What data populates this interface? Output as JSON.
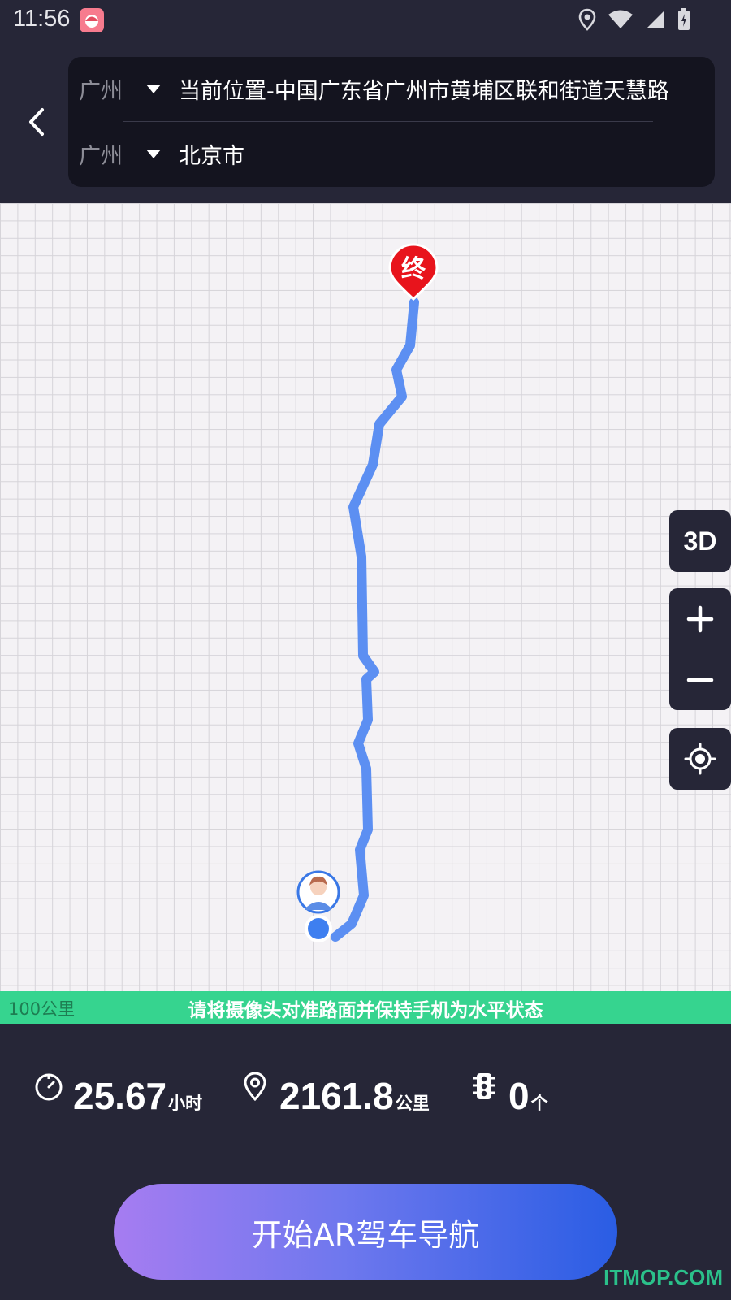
{
  "status_bar": {
    "time": "11:56",
    "icons": [
      "app-icon",
      "location-icon",
      "wifi-icon",
      "signal-icon",
      "battery-icon"
    ]
  },
  "route": {
    "start": {
      "city": "广州",
      "place": "当前位置-中国广东省广州市黄埔区联和街道天慧路"
    },
    "end": {
      "city": "广州",
      "place": "北京市"
    }
  },
  "map": {
    "end_marker_label": "终",
    "mode_button_label": "3D",
    "scale_label": "100公里",
    "route_color": "#5c8ff2",
    "marker_color": "#e8141c"
  },
  "tip": {
    "text": "请将摄像头对准路面并保持手机为水平状态",
    "background": "#36d48f"
  },
  "stats": {
    "duration_value": "25.67",
    "duration_unit": "小时",
    "distance_value": "2161.8",
    "distance_unit": "公里",
    "lights_value": "0",
    "lights_unit": "个"
  },
  "action": {
    "start_label": "开始AR驾车导航"
  },
  "watermark": "ITMOP.COM"
}
